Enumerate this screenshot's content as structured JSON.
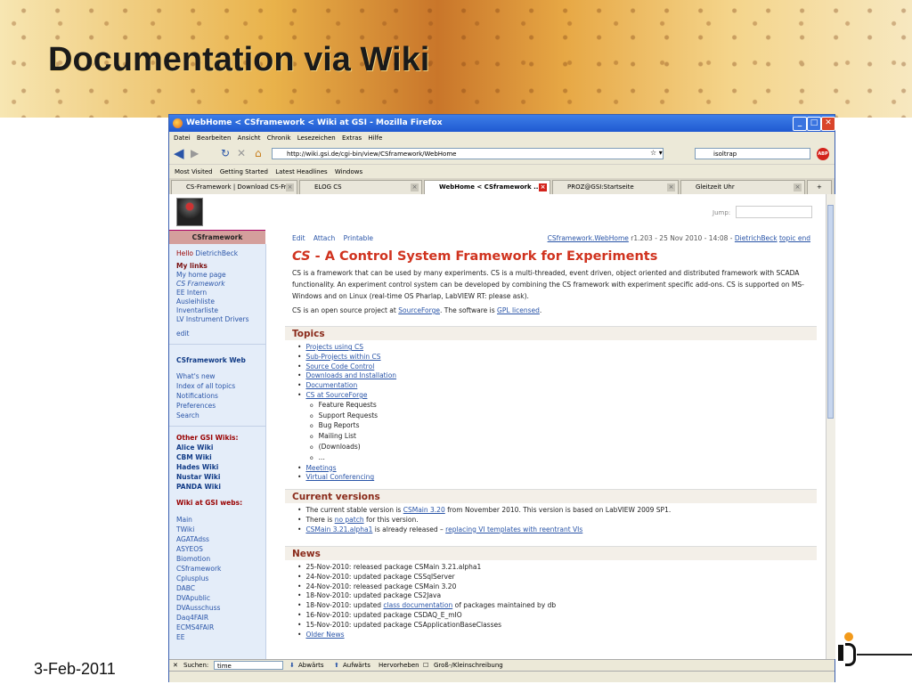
{
  "slide": {
    "title": "Documentation via Wiki",
    "date": "3-Feb-2011"
  },
  "browser": {
    "window_title": "WebHome < CSframework < Wiki at GSI - Mozilla Firefox",
    "menu": [
      "Datei",
      "Bearbeiten",
      "Ansicht",
      "Chronik",
      "Lesezeichen",
      "Extras",
      "Hilfe"
    ],
    "url": "http://wiki.gsi.de/cgi-bin/view/CSframework/WebHome",
    "search_value": "isoltrap",
    "abp_label": "ABP",
    "bookmarks": [
      "Most Visited",
      "Getting Started",
      "Latest Headlines",
      "Windows"
    ],
    "tabs": [
      {
        "label": "CS-Framework | Download CS-Fr..."
      },
      {
        "label": "ELOG CS"
      },
      {
        "label": "WebHome < CSframework ..."
      },
      {
        "label": "PROZ@GSI:Startseite"
      },
      {
        "label": "Gleitzeit Uhr"
      }
    ],
    "find": {
      "label": "Suchen:",
      "value": "time",
      "down": "Abwärts",
      "up": "Aufwärts",
      "highlight": "Hervorheben",
      "case": "Groß-/Kleinschreibung"
    }
  },
  "wiki": {
    "jump_label": "Jump:",
    "sidebar_title": "CSframework",
    "hello": "Hello",
    "user": "DietrichBeck",
    "my_links": "My links",
    "links": [
      "My home page",
      "CS Framework",
      "EE Intern",
      "Ausleihliste",
      "Inventarliste",
      "LV Instrument Drivers"
    ],
    "edit": "edit",
    "web_title": "CSframework Web",
    "web_links": [
      "What's new",
      "Index of all topics",
      "Notifications",
      "Preferences",
      "Search"
    ],
    "other_wikis_title": "Other GSI Wikis:",
    "other_wikis": [
      "Alice Wiki",
      "CBM Wiki",
      "Hades Wiki",
      "Nustar Wiki",
      "PANDA Wiki"
    ],
    "webs_title": "Wiki at GSI webs:",
    "webs": [
      "Main",
      "TWiki",
      "AGATAdss",
      "ASYEOS",
      "Biomotion",
      "CSframework",
      "Cplusplus",
      "DABC",
      "DVApublic",
      "DVAusschuss",
      "Daq4FAIR",
      "ECMS4FAIR",
      "EE"
    ],
    "actions": [
      "Edit",
      "Attach",
      "Printable"
    ],
    "revision": {
      "topic": "CSframework.WebHome",
      "info": "r1.203 - 25 Nov 2010 - 14:08 -",
      "author": "DietrichBeck",
      "topic_end": "topic end"
    },
    "heading_cs": "CS",
    "heading_rest": "- A Control System Framework for Experiments",
    "intro1": "CS is a framework that can be used by many experiments. CS is a multi-threaded, event driven, object oriented and distributed framework with SCADA functionality. An experiment control system can be developed by combining the CS framework with experiment specific add-ons. CS is supported on MS-Windows and on Linux (real-time OS Pharlap, LabVIEW RT: please ask).",
    "intro2_a": "CS is an open source project at",
    "intro2_link1": "SourceForge",
    "intro2_b": ". The software is",
    "intro2_link2": "GPL licensed",
    "intro2_c": ".",
    "topics_title": "Topics",
    "topics": [
      "Projects using CS",
      "Sub-Projects within CS",
      "Source Code Control",
      "Downloads and Installation",
      "Documentation",
      "CS at SourceForge"
    ],
    "topics_sub": [
      "Feature Requests",
      "Support Requests",
      "Bug Reports",
      "Mailing List",
      "(Downloads)",
      "..."
    ],
    "topics_after": [
      "Meetings",
      "Virtual Conferencing"
    ],
    "current_title": "Current versions",
    "cv1_a": "The current stable version is",
    "cv1_link": "CSMain 3.20",
    "cv1_b": "from November 2010. This version is based on LabVIEW 2009 SP1.",
    "cv2_a": "There is",
    "cv2_link": "no patch",
    "cv2_b": "for this version.",
    "cv3_link": "CSMain 3.21.alpha1",
    "cv3_b": "is already released –",
    "cv3_link2": "replacing VI templates with reentrant VIs",
    "news_title": "News",
    "news": [
      "25-Nov-2010: released package CSMain 3.21.alpha1",
      "24-Nov-2010: updated package CSSqlServer",
      "24-Nov-2010: released package CSMain 3.20",
      "18-Nov-2010: updated package CS2Java",
      "18-Nov-2010: updated",
      "16-Nov-2010: updated package CSDAQ_E_mIO",
      "15-Nov-2010: updated package CSApplicationBaseClasses"
    ],
    "news5_link": "class documentation",
    "news5_b": "of packages maintained by db",
    "older_news": "Older News"
  }
}
